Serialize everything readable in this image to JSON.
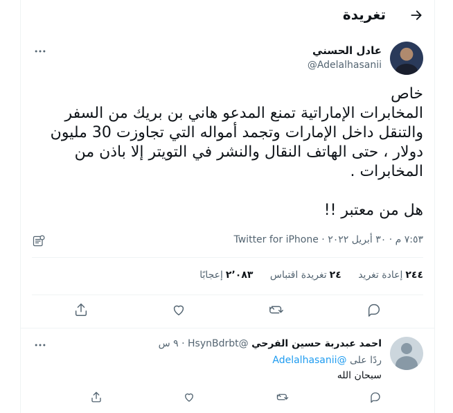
{
  "header": {
    "title": "تغريدة",
    "back_icon": "arrow-right-icon"
  },
  "tweet": {
    "author_name": "عادل الحسني",
    "author_handle": "@Adelalhasanii",
    "lines": [
      "خاص",
      "المخابرات الإماراتية تمنع المدعو هاني بن بريك من السفر",
      "والتنقل داخل الإمارات وتجمد أمواله التي تجاوزت 30 مليون",
      "دولار ، حتى الهاتف النقال والنشر في التويتر إلا باذن من",
      "المخابرات ."
    ],
    "closing_line": "هل من معتبر !!",
    "timestamp": "٧:٥٣ م · ٣٠ أبريل ٢٠٢٢",
    "separator": "·",
    "source": "Twitter for iPhone",
    "stats": [
      {
        "count": "٢٤٤",
        "label": "إعادة تغريد"
      },
      {
        "count": "٢٤",
        "label": "تغريدة اقتباس"
      },
      {
        "count": "٢٬٠٨٣",
        "label": "إعجابًا"
      }
    ]
  },
  "reply": {
    "author_name": "احمد عبدربة حسين الفرحي",
    "author_handle": "@HsynBdrbt",
    "separator": "·",
    "time": "٩ س",
    "replying_prefix": "ردًا على",
    "replying_to": "@Adelalhasanii",
    "text": "سبحان الله"
  },
  "colors": {
    "accent": "#1d9bf0",
    "text": "#0f1419",
    "muted": "#536471",
    "divider": "#eff3f4"
  }
}
